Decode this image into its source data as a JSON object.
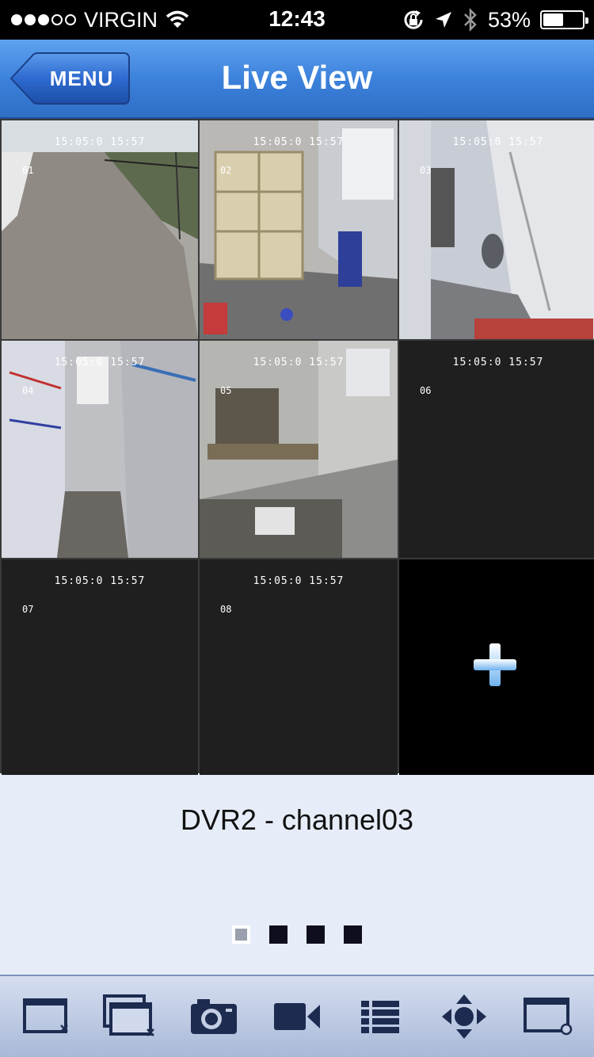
{
  "status_bar": {
    "carrier": "VIRGIN",
    "time": "12:43",
    "battery": "53%",
    "battery_level": 0.53
  },
  "nav": {
    "menu_label": "MENU",
    "title": "Live View"
  },
  "grid": {
    "osd_text": "15:05:0 15:57",
    "cells": [
      {
        "channel": "01",
        "has_video": true
      },
      {
        "channel": "02",
        "has_video": true
      },
      {
        "channel": "03",
        "has_video": true,
        "selected": true
      },
      {
        "channel": "04",
        "has_video": true
      },
      {
        "channel": "05",
        "has_video": true
      },
      {
        "channel": "06",
        "has_video": false
      },
      {
        "channel": "07",
        "has_video": false
      },
      {
        "channel": "08",
        "has_video": false
      },
      {
        "add": true
      }
    ]
  },
  "info": {
    "channel_name": "DVR2 - channel03",
    "pages": 4,
    "current_page": 1
  },
  "toolbar": {
    "icons": [
      "close-channel-icon",
      "close-all-icon",
      "snapshot-icon",
      "record-icon",
      "list-icon",
      "ptz-icon",
      "window-settings-icon"
    ]
  },
  "colors": {
    "nav_blue": "#3a7fd9",
    "accent": "#6fa3e8",
    "icon_navy": "#1c2b4f"
  }
}
